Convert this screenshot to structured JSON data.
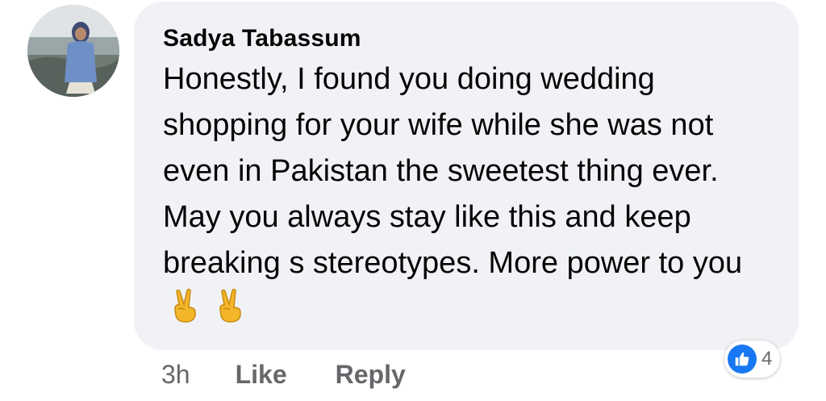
{
  "comment": {
    "author": "Sadya Tabassum",
    "text": "Honestly, I found you doing wedding shopping for your wife while she was not even in Pakistan the sweetest thing ever. May you always stay like this and keep breaking s stereotypes. More power to you",
    "emojis": [
      "victory-hand-emoji",
      "victory-hand-emoji"
    ]
  },
  "actions": {
    "time": "3h",
    "like": "Like",
    "reply": "Reply"
  },
  "reactions": {
    "icon": "thumbs-up-icon",
    "count": "4"
  },
  "colors": {
    "bubble": "#f0f2f5",
    "action_text": "#65676b",
    "like_blue": "#1877f2"
  }
}
